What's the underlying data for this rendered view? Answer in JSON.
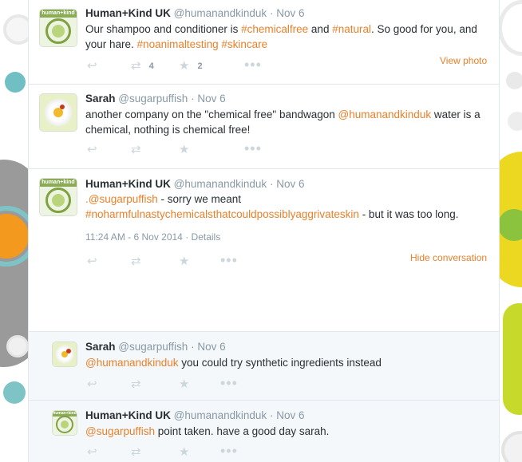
{
  "tweets": [
    {
      "name": "Human+Kind UK",
      "handle": "@humanandkinduk",
      "sep": "·",
      "date": "Nov 6",
      "body": [
        {
          "t": "Our shampoo and conditioner is "
        },
        {
          "t": "#chemicalfree",
          "link": true
        },
        {
          "t": " and "
        },
        {
          "t": "#natural",
          "link": true
        },
        {
          "t": ". So good for you, and your hare. "
        },
        {
          "t": "#noanimaltesting",
          "link": true
        },
        {
          "t": " "
        },
        {
          "t": "#skincare",
          "link": true
        }
      ],
      "retweet_count": "4",
      "favorite_count": "2",
      "right_link": "View photo",
      "avatar_text": "human+kind"
    },
    {
      "name": "Sarah",
      "handle": "@sugarpuffish",
      "sep": "·",
      "date": "Nov 6",
      "body": [
        {
          "t": "another company on the \"chemical free\" bandwagon "
        },
        {
          "t": "@humanandkinduk",
          "link": true
        },
        {
          "t": " water is a chemical, nothing is chemical free!"
        }
      ]
    },
    {
      "name": "Human+Kind UK",
      "handle": "@humanandkinduk",
      "sep": "·",
      "date": "Nov 6",
      "body": [
        {
          "t": ".@sugarpuffish",
          "link": true
        },
        {
          "t": " - sorry we meant "
        },
        {
          "t": "#noharmfulnastychemicalsthatcouldpossiblyaggrivateskin",
          "link": true
        },
        {
          "t": " - but it was too long."
        }
      ],
      "timestamp": "11:24 AM - 6 Nov 2014",
      "details_sep": "·",
      "details": "Details",
      "right_link": "Hide conversation",
      "avatar_text": "human+kind"
    },
    {
      "name": "Sarah",
      "handle": "@sugarpuffish",
      "sep": "·",
      "date": "Nov 6",
      "body": [
        {
          "t": "@humanandkinduk",
          "link": true
        },
        {
          "t": " you could try synthetic ingredients instead"
        }
      ]
    },
    {
      "name": "Human+Kind UK",
      "handle": "@humanandkinduk",
      "sep": "·",
      "date": "Nov 6",
      "body": [
        {
          "t": "@sugarpuffish",
          "link": true
        },
        {
          "t": " point taken. have a good day sarah."
        }
      ],
      "avatar_text": "human+kind"
    }
  ],
  "icons": {
    "reply": "reply-icon",
    "retweet": "retweet-icon",
    "favorite": "star-icon",
    "more": "more-icon"
  },
  "colors": {
    "link": "#e8812b",
    "meta": "#8899a6",
    "icon": "#ccd6dd"
  }
}
